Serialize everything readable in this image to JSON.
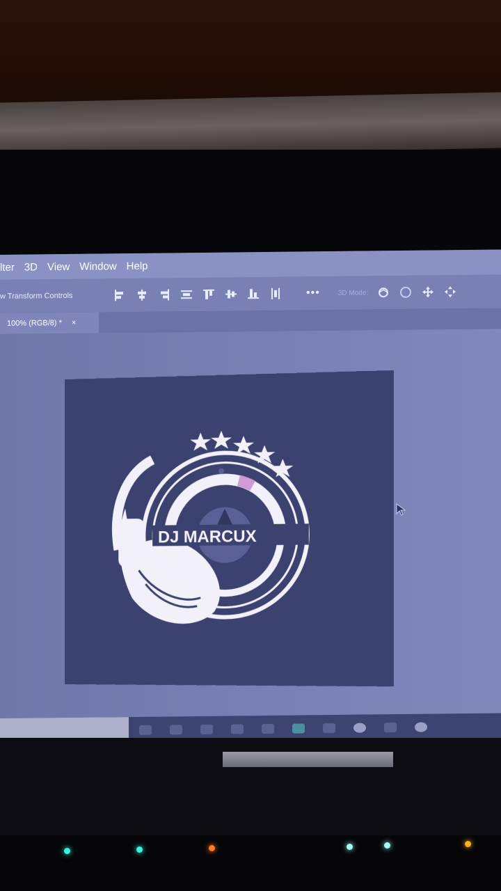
{
  "menubar": {
    "items": [
      "lter",
      "3D",
      "View",
      "Window",
      "Help"
    ]
  },
  "options_bar": {
    "transform_label": "w Transform Controls",
    "more_label": "•••",
    "mode_3d_label": "3D Mode:"
  },
  "document_tab": {
    "label": "100% (RGB/8) *",
    "close": "×"
  },
  "artwork": {
    "brand_text": "DJ MARCUX",
    "stars": 5
  },
  "colors": {
    "screen_bg": "#6e76a8",
    "artboard_bg": "#3c4270",
    "logo_fill": "#f2f0f8",
    "accent_pink": "#d09ad6"
  }
}
